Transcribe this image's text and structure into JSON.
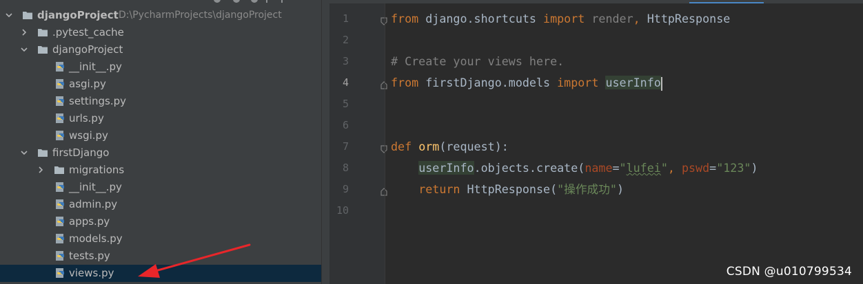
{
  "project_tree": {
    "items": [
      {
        "label": "djangoProject",
        "path": "D:\\PycharmProjects\\djangoProject",
        "kind": "folder",
        "expanded": true,
        "depth": 0
      },
      {
        "label": ".pytest_cache",
        "kind": "folder",
        "expanded": false,
        "depth": 1
      },
      {
        "label": "djangoProject",
        "kind": "folder",
        "expanded": true,
        "depth": 1
      },
      {
        "label": "__init__.py",
        "kind": "python-file",
        "depth": 2
      },
      {
        "label": "asgi.py",
        "kind": "python-file",
        "depth": 2
      },
      {
        "label": "settings.py",
        "kind": "python-file",
        "depth": 2
      },
      {
        "label": "urls.py",
        "kind": "python-file",
        "depth": 2
      },
      {
        "label": "wsgi.py",
        "kind": "python-file",
        "depth": 2
      },
      {
        "label": "firstDjango",
        "kind": "folder",
        "expanded": true,
        "depth": 1
      },
      {
        "label": "migrations",
        "kind": "folder",
        "expanded": false,
        "depth": 2
      },
      {
        "label": "__init__.py",
        "kind": "python-file",
        "depth": 2
      },
      {
        "label": "admin.py",
        "kind": "python-file",
        "depth": 2
      },
      {
        "label": "apps.py",
        "kind": "python-file",
        "depth": 2
      },
      {
        "label": "models.py",
        "kind": "python-file",
        "depth": 2
      },
      {
        "label": "tests.py",
        "kind": "python-file",
        "depth": 2
      },
      {
        "label": "views.py",
        "kind": "python-file",
        "depth": 2,
        "selected": true
      }
    ]
  },
  "editor": {
    "line_numbers": [
      "1",
      "2",
      "3",
      "4",
      "5",
      "6",
      "7",
      "8",
      "9",
      "10"
    ],
    "current_line": "4",
    "code": {
      "l1": {
        "kw1": "from",
        "mod": " django.shortcuts ",
        "kw2": "import",
        "unused": " render",
        "comma": ",",
        "name": " HttpResponse"
      },
      "l3": {
        "comment": "# Create your views here."
      },
      "l4": {
        "kw1": "from",
        "mod": " firstDjango.models ",
        "kw2": "import",
        "space": " ",
        "name": "userInfo"
      },
      "l7": {
        "kw": "def",
        "space": " ",
        "fn": "orm",
        "args": "(request):"
      },
      "l8": {
        "indent": "    ",
        "obj": "userInfo",
        "call": ".objects.create(",
        "p1": "name",
        "eq1": "=",
        "s1a": "\"",
        "s1b": "lufei",
        "s1c": "\"",
        "comma": ", ",
        "p2": "pswd",
        "eq2": "=",
        "s2": "\"123\"",
        "close": ")"
      },
      "l9": {
        "indent": "    ",
        "kw": "return",
        "call": " HttpResponse(",
        "s": "\"操作成功\"",
        "close": ")"
      }
    }
  },
  "watermark": "CSDN @u010799534",
  "colors": {
    "sidebar_bg": "#3c3f41",
    "editor_bg": "#2b2b2b",
    "selection_bg": "#0d293e",
    "keyword": "#cc7832",
    "string": "#6a8759",
    "comment": "#808080",
    "function": "#ffc66d",
    "param": "#aa4926",
    "arrow": "#e8262a"
  }
}
